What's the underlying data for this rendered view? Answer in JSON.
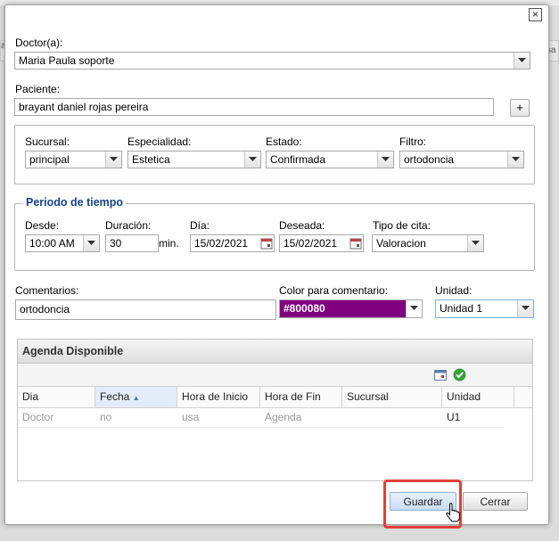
{
  "background": {
    "left_tab": "a",
    "right_tab": "ursa"
  },
  "dialog": {
    "close_glyph": "×",
    "doctor": {
      "label": "Doctor(a):",
      "value": "Maria Paula soporte"
    },
    "paciente": {
      "label": "Paciente:",
      "value": "brayant daniel rojas pereira",
      "add_glyph": "+"
    },
    "filters": {
      "sucursal": {
        "label": "Sucursal:",
        "value": "principal"
      },
      "especialidad": {
        "label": "Especialidad:",
        "value": "Estetica"
      },
      "estado": {
        "label": "Estado:",
        "value": "Confirmada"
      },
      "filtro": {
        "label": "Filtro:",
        "value": "ortodoncia"
      }
    },
    "periodo": {
      "legend": "Periodo de tiempo",
      "desde": {
        "label": "Desde:",
        "value": "10:00 AM"
      },
      "duracion": {
        "label": "Duración:",
        "value": "30",
        "unit": "min."
      },
      "dia": {
        "label": "Día:",
        "value": "15/02/2021"
      },
      "deseada": {
        "label": "Deseada:",
        "value": "15/02/2021"
      },
      "tipo_cita": {
        "label": "Tipo de cita:",
        "value": "Valoracion"
      }
    },
    "comentarios": {
      "label": "Comentarios:",
      "value": "ortodoncia"
    },
    "color_comentario": {
      "label": "Color para comentario:",
      "value": "#800080",
      "color": "#800080"
    },
    "unidad": {
      "label": "Unidad:",
      "value": "Unidad 1"
    },
    "agenda": {
      "title": "Agenda Disponible",
      "columns": [
        "Dia",
        "Fecha",
        "Hora de Inicio",
        "Hora de Fin",
        "Sucursal",
        "Unidad"
      ],
      "sorted_column": "Fecha",
      "sort_glyph": "▲",
      "row": [
        "Doctor",
        "no",
        "usa",
        "Agenda",
        "",
        "U1"
      ]
    },
    "buttons": {
      "guardar": "Guardar",
      "cerrar": "Cerrar"
    }
  }
}
